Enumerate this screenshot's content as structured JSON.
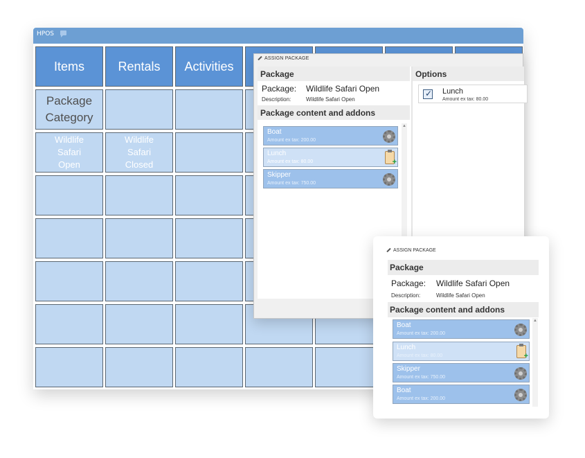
{
  "window": {
    "title": "HPOS"
  },
  "grid": {
    "headers": [
      "Items",
      "Rentals",
      "Activities",
      "",
      "",
      "",
      ""
    ],
    "category": {
      "label_line1": "Package",
      "label_line2": "Category"
    },
    "packages": [
      {
        "line1": "Wildlife",
        "line2": "Safari",
        "line3": "Open"
      },
      {
        "line1": "Wildlife",
        "line2": "Safari",
        "line3": "Closed"
      }
    ]
  },
  "dialog": {
    "title": "ASSIGN PACKAGE",
    "package_section": "Package",
    "package_label": "Package:",
    "package_value": "Wildlife Safari Open",
    "description_label": "Description:",
    "description_value": "Wildlife Safari Open",
    "content_section": "Package content and addons",
    "addons": [
      {
        "name": "Boat",
        "amount": "Amount ex tax: 200.00",
        "icon": "gear-icon"
      },
      {
        "name": "Lunch",
        "amount": "Amount ex tax: 80.00",
        "icon": "clipboard-add-icon"
      },
      {
        "name": "Skipper",
        "amount": "Amount ex tax: 750.00",
        "icon": "gear-icon"
      }
    ],
    "options_section": "Options",
    "options": [
      {
        "name": "Lunch",
        "amount": "Amount ex tax: 80.00",
        "checked": true
      }
    ]
  },
  "zoom": {
    "title": "ASSIGN PACKAGE",
    "package_section": "Package",
    "package_label": "Package:",
    "package_value": "Wildlife Safari Open",
    "description_label": "Description:",
    "description_value": "Wildlife Safari Open",
    "content_section": "Package content and addons",
    "addons": [
      {
        "name": "Boat",
        "amount": "Amount ex tax: 200.00",
        "icon": "gear-icon"
      },
      {
        "name": "Lunch",
        "amount": "Amount ex tax: 80.00",
        "icon": "clipboard-add-icon"
      },
      {
        "name": "Skipper",
        "amount": "Amount ex tax: 750.00",
        "icon": "gear-icon"
      },
      {
        "name": "Boat",
        "amount": "Amount ex tax: 200.00",
        "icon": "gear-icon"
      }
    ]
  },
  "colors": {
    "titlebar": "#6d9fd3",
    "tile_header": "#5b93d6",
    "tile": "#c0d8f2",
    "addon": "#9dc1eb",
    "addon_light": "#cfe1f6"
  }
}
